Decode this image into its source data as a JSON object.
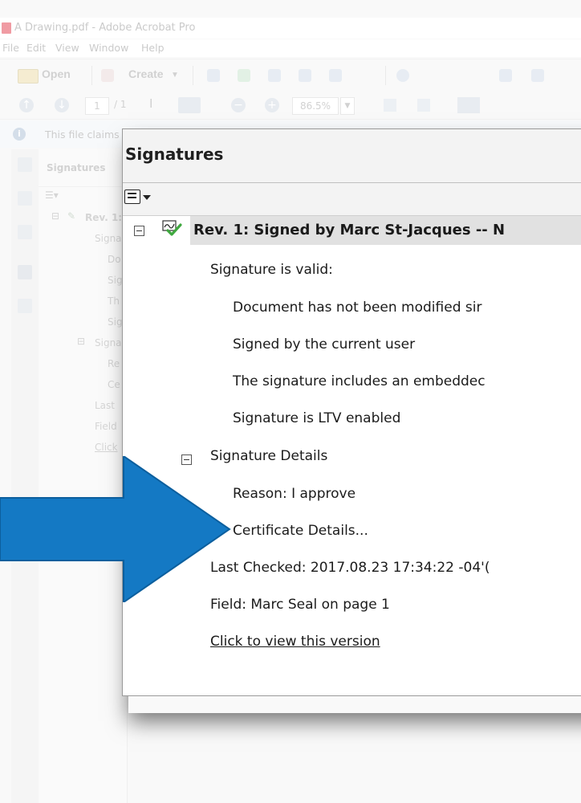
{
  "window": {
    "title": "A Drawing.pdf - Adobe Acrobat Pro"
  },
  "menubar": [
    "File",
    "Edit",
    "View",
    "Window",
    "Help"
  ],
  "toolbar": {
    "open_label": "Open",
    "create_label": "Create",
    "page_current": "1",
    "page_total": "/ 1",
    "zoom": "86.5%"
  },
  "infobar": {
    "text": "This file claims"
  },
  "navpanel": {
    "header": "Signatures",
    "rev": "Rev. 1:",
    "lines": [
      "Signa",
      "Do",
      "Sig",
      "Th",
      "Sig",
      "Signa",
      "Re",
      "Ce",
      "Last",
      "Field",
      "Click"
    ]
  },
  "panel": {
    "title": "Signatures",
    "rev_label": "Rev. 1: Signed by Marc St-Jacques -- N",
    "validity": "Signature is valid:",
    "checks": [
      "Document has not been modified sir",
      "Signed by the current user",
      "The signature includes an embeddec",
      "Signature is LTV enabled"
    ],
    "details_label": "Signature Details",
    "reason": "Reason: I approve",
    "certificate": "Certificate Details...",
    "last_checked": "Last Checked: 2017.08.23 17:34:22 -04'(",
    "field": "Field: Marc Seal on page 1",
    "view_version": "Click to view this version"
  },
  "colors": {
    "arrow": "#1479c4",
    "arrow_edge": "#0c5f9e",
    "selected_row": "#e1e1e1"
  }
}
